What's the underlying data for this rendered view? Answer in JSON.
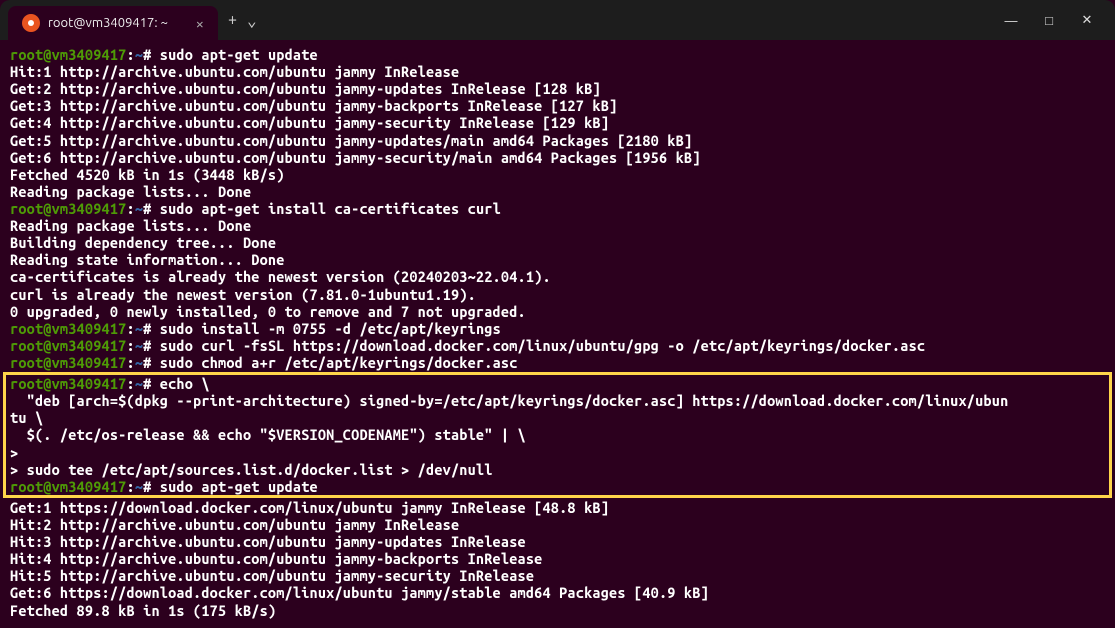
{
  "window": {
    "tab_title": "root@vm3409417: ~",
    "prompt_user": "root@vm3409417",
    "prompt_path": "~",
    "prompt_suffix": "#"
  },
  "icons": {
    "close_tab": "×",
    "new_tab": "+",
    "dropdown": "⌄",
    "minimize": "—",
    "maximize": "□",
    "close_window": "✕"
  },
  "blocks": [
    {
      "type": "prompt_line",
      "command": "sudo apt-get update"
    },
    {
      "type": "output",
      "text": "Hit:1 http://archive.ubuntu.com/ubuntu jammy InRelease"
    },
    {
      "type": "output",
      "text": "Get:2 http://archive.ubuntu.com/ubuntu jammy-updates InRelease [128 kB]"
    },
    {
      "type": "output",
      "text": "Get:3 http://archive.ubuntu.com/ubuntu jammy-backports InRelease [127 kB]"
    },
    {
      "type": "output",
      "text": "Get:4 http://archive.ubuntu.com/ubuntu jammy-security InRelease [129 kB]"
    },
    {
      "type": "output",
      "text": "Get:5 http://archive.ubuntu.com/ubuntu jammy-updates/main amd64 Packages [2180 kB]"
    },
    {
      "type": "output",
      "text": "Get:6 http://archive.ubuntu.com/ubuntu jammy-security/main amd64 Packages [1956 kB]"
    },
    {
      "type": "output",
      "text": "Fetched 4520 kB in 1s (3448 kB/s)"
    },
    {
      "type": "output",
      "text": "Reading package lists... Done"
    },
    {
      "type": "prompt_line",
      "command": "sudo apt-get install ca-certificates curl"
    },
    {
      "type": "output",
      "text": "Reading package lists... Done"
    },
    {
      "type": "output",
      "text": "Building dependency tree... Done"
    },
    {
      "type": "output",
      "text": "Reading state information... Done"
    },
    {
      "type": "output",
      "text": "ca-certificates is already the newest version (20240203~22.04.1)."
    },
    {
      "type": "output",
      "text": "curl is already the newest version (7.81.0-1ubuntu1.19)."
    },
    {
      "type": "output",
      "text": "0 upgraded, 0 newly installed, 0 to remove and 7 not upgraded."
    },
    {
      "type": "prompt_line",
      "command": "sudo install -m 0755 -d /etc/apt/keyrings"
    },
    {
      "type": "prompt_line",
      "command": "sudo curl -fsSL https://download.docker.com/linux/ubuntu/gpg -o /etc/apt/keyrings/docker.asc"
    },
    {
      "type": "prompt_line",
      "command": "sudo chmod a+r /etc/apt/keyrings/docker.asc"
    },
    {
      "type": "highlight_start"
    },
    {
      "type": "prompt_line",
      "command": "echo \\"
    },
    {
      "type": "output",
      "text": "  \"deb [arch=$(dpkg --print-architecture) signed-by=/etc/apt/keyrings/docker.asc] https://download.docker.com/linux/ubun"
    },
    {
      "type": "output",
      "text": "tu \\"
    },
    {
      "type": "output",
      "text": "  $(. /etc/os-release && echo \"$VERSION_CODENAME\") stable\" | \\"
    },
    {
      "type": "output",
      "text": ">"
    },
    {
      "type": "output",
      "text": "> sudo tee /etc/apt/sources.list.d/docker.list > /dev/null"
    },
    {
      "type": "prompt_line",
      "command": "sudo apt-get update"
    },
    {
      "type": "highlight_end"
    },
    {
      "type": "output",
      "text": "Get:1 https://download.docker.com/linux/ubuntu jammy InRelease [48.8 kB]"
    },
    {
      "type": "output",
      "text": "Hit:2 http://archive.ubuntu.com/ubuntu jammy InRelease"
    },
    {
      "type": "output",
      "text": "Hit:3 http://archive.ubuntu.com/ubuntu jammy-updates InRelease"
    },
    {
      "type": "output",
      "text": "Hit:4 http://archive.ubuntu.com/ubuntu jammy-backports InRelease"
    },
    {
      "type": "output",
      "text": "Hit:5 http://archive.ubuntu.com/ubuntu jammy-security InRelease"
    },
    {
      "type": "output",
      "text": "Get:6 https://download.docker.com/linux/ubuntu jammy/stable amd64 Packages [40.9 kB]"
    },
    {
      "type": "output",
      "text": "Fetched 89.8 kB in 1s (175 kB/s)"
    }
  ]
}
